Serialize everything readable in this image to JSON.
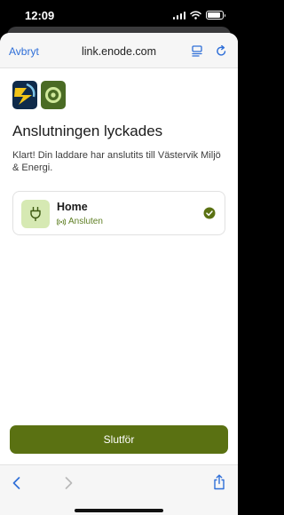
{
  "status_bar": {
    "time": "12:09"
  },
  "browser": {
    "cancel_label": "Avbryt",
    "url": "link.enode.com"
  },
  "page": {
    "title": "Anslutningen lyckades",
    "description": "Klart! Din laddare har anslutits till Västervik Miljö & Energi."
  },
  "charger": {
    "name": "Home",
    "status": "Ansluten"
  },
  "finish_button": {
    "label": "Slutför"
  },
  "colors": {
    "accent_green": "#5a7112",
    "status_green": "#5f7f24",
    "link_blue": "#2f6fd8",
    "plug_tile": "#d6e9b3"
  },
  "icons": {
    "reader": "reader-mode-icon",
    "reload": "reload-icon",
    "plug": "plug-icon",
    "connected": "radio-waves-icon",
    "check": "check-circle-icon",
    "back": "chevron-left-icon",
    "forward": "chevron-right-icon",
    "share": "share-icon"
  }
}
